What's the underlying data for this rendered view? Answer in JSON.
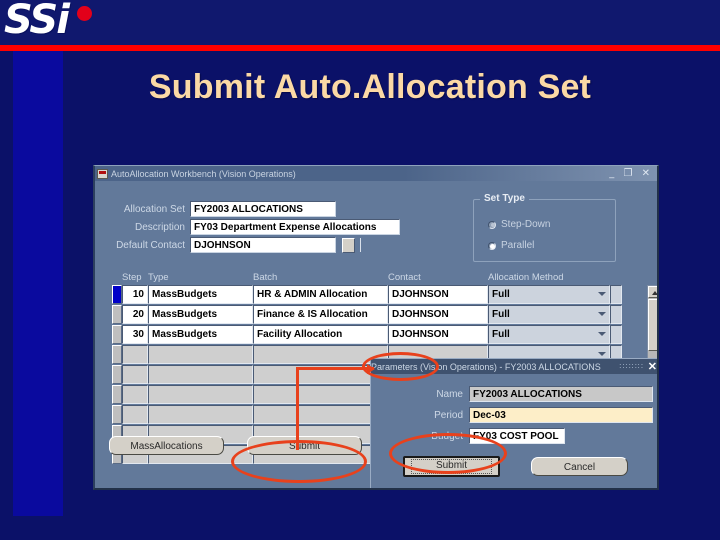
{
  "slide": {
    "logo_text": "SSi",
    "title": "Submit Auto.Allocation Set"
  },
  "app_window": {
    "title": "AutoAllocation Workbench (Vision Operations)",
    "window_buttons": "_ ❐ ✕",
    "header_fields": [
      {
        "label": "Allocation Set",
        "value": "FY2003 ALLOCATIONS"
      },
      {
        "label": "Description",
        "value": "FY03 Department Expense Allocations"
      },
      {
        "label": "Default Contact",
        "value": "DJOHNSON"
      }
    ],
    "set_type": {
      "legend": "Set Type",
      "options": [
        {
          "label": "Step-Down",
          "selected": false
        },
        {
          "label": "Parallel",
          "selected": true
        }
      ]
    },
    "grid": {
      "columns": [
        "Step",
        "Type",
        "Batch",
        "Contact",
        "Allocation Method"
      ],
      "rows": [
        {
          "step": "10",
          "type": "MassBudgets",
          "batch": "HR & ADMIN Allocation",
          "contact": "DJOHNSON",
          "method": "Full"
        },
        {
          "step": "20",
          "type": "MassBudgets",
          "batch": "Finance & IS Allocation",
          "contact": "DJOHNSON",
          "method": "Full"
        },
        {
          "step": "30",
          "type": "MassBudgets",
          "batch": "Facility Allocation",
          "contact": "DJOHNSON",
          "method": "Full"
        }
      ],
      "empty_row_count": 6
    },
    "buttons": {
      "mass_allocations": "MassAllocations",
      "submit": "Submit"
    }
  },
  "params_dialog": {
    "title": "Parameters (Vision Operations) - FY2003 ALLOCATIONS",
    "title_dots": "∷∷∷∷",
    "close": "✕",
    "fields": [
      {
        "label": "Name",
        "value": "FY2003 ALLOCATIONS",
        "style": "grey"
      },
      {
        "label": "Period",
        "value": "Dec-03",
        "style": "cream"
      },
      {
        "label": "Budget",
        "value": "FY03 COST POOL",
        "style": "white"
      }
    ],
    "buttons": {
      "submit": "Submit",
      "cancel": "Cancel"
    }
  },
  "colors": {
    "slide_background": "#0b1168",
    "accent_strip": "#0a0a9e",
    "rule": "#ff0000",
    "title_text": "#fbd9a5",
    "form_background": "#62799a",
    "annotation": "#e8411c",
    "selection": "#0000c8"
  }
}
